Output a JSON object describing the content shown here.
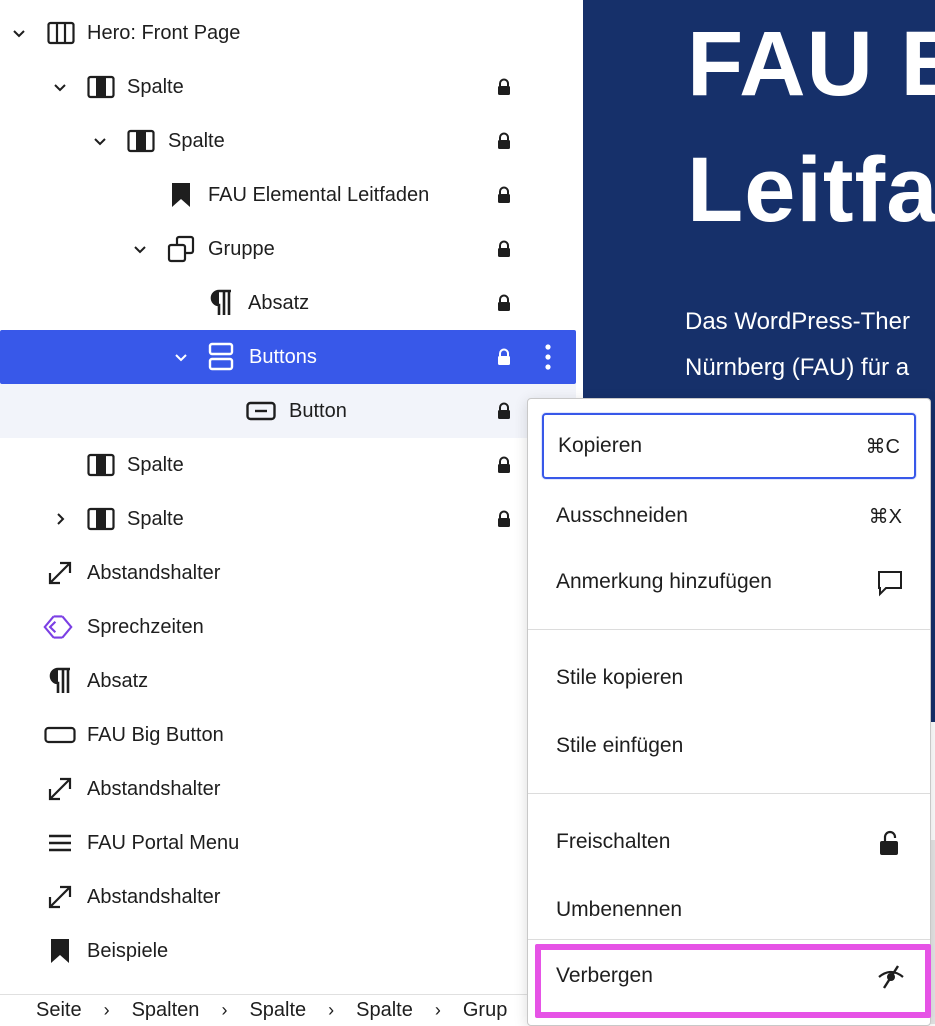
{
  "canvas": {
    "heading_line1": "FAU E",
    "heading_line2": "Leitfa",
    "lead_line1": "Das WordPress-Ther",
    "lead_line2": "Nürnberg (FAU) für a"
  },
  "tree": {
    "items": [
      {
        "label": "Hero: Front Page",
        "icon": "columns-icon"
      },
      {
        "label": "Spalte",
        "icon": "column-icon"
      },
      {
        "label": "Spalte",
        "icon": "column-icon"
      },
      {
        "label": "FAU Elemental Leitfaden",
        "icon": "bookmark-icon"
      },
      {
        "label": "Gruppe",
        "icon": "group-icon"
      },
      {
        "label": "Absatz",
        "icon": "paragraph-icon"
      },
      {
        "label": "Buttons",
        "icon": "buttons-icon"
      },
      {
        "label": "Button",
        "icon": "button-icon"
      },
      {
        "label": "Spalte",
        "icon": "column-icon"
      },
      {
        "label": "Spalte",
        "icon": "column-icon"
      },
      {
        "label": "Abstandshalter",
        "icon": "spacer-icon"
      },
      {
        "label": "Sprechzeiten",
        "icon": "diamond-icon"
      },
      {
        "label": "Absatz",
        "icon": "paragraph-icon"
      },
      {
        "label": "FAU Big Button",
        "icon": "big-button-icon"
      },
      {
        "label": "Abstandshalter",
        "icon": "spacer-icon"
      },
      {
        "label": "FAU Portal Menu",
        "icon": "menu-icon"
      },
      {
        "label": "Abstandshalter",
        "icon": "spacer-icon"
      },
      {
        "label": "Beispiele",
        "icon": "bookmark-icon"
      }
    ]
  },
  "breadcrumb": [
    "Seite",
    "Spalten",
    "Spalte",
    "Spalte",
    "Grup"
  ],
  "menu": {
    "copy": "Kopieren",
    "copy_shortcut": "⌘C",
    "cut": "Ausschneiden",
    "cut_shortcut": "⌘X",
    "add_note": "Anmerkung hinzufügen",
    "copy_styles": "Stile kopieren",
    "paste_styles": "Stile einfügen",
    "unlock": "Freischalten",
    "rename": "Umbenennen",
    "hide": "Verbergen"
  },
  "colors": {
    "accent": "#3858e9",
    "canvas_bg": "#16306a",
    "highlight": "#e653e6",
    "icon_purple": "#7b3fe4"
  }
}
